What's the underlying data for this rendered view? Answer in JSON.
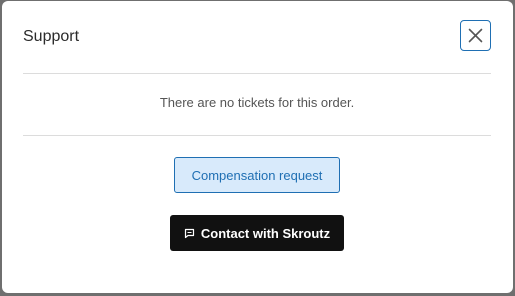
{
  "modal": {
    "title": "Support",
    "close_icon": "close-icon",
    "empty_message": "There are no tickets for this order.",
    "compensation_label": "Compensation request",
    "contact_label": "Contact with Skroutz",
    "contact_icon": "chat-icon"
  },
  "colors": {
    "accent": "#1f6fb3",
    "accent_bg": "#d8eafb",
    "dark_button": "#111111",
    "backdrop": "#6f6f6f"
  }
}
